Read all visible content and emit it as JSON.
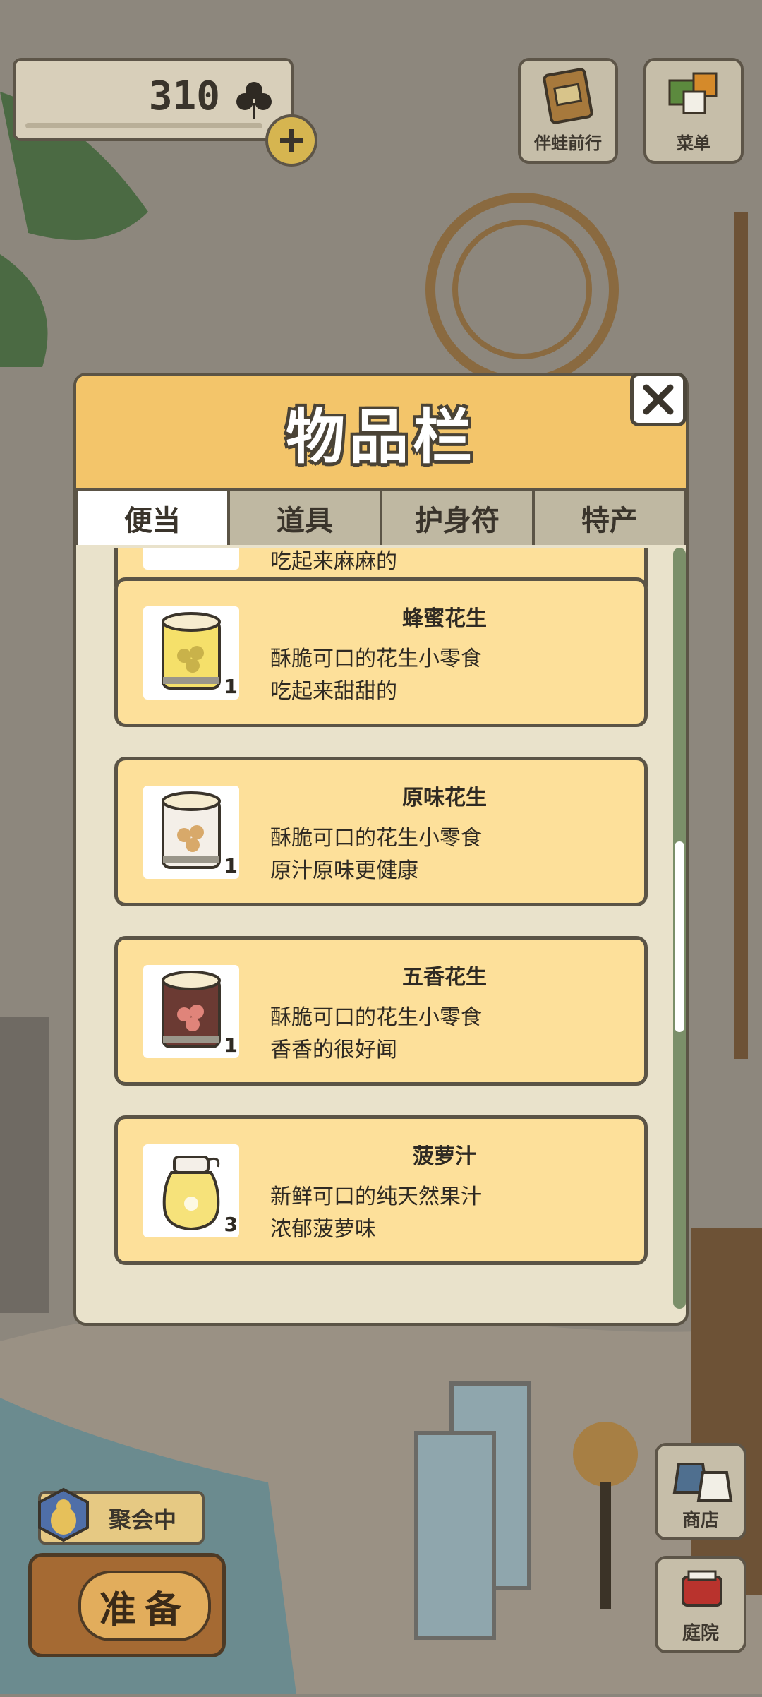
{
  "hud": {
    "clover_count": "310",
    "travel_label": "伴蛙前行",
    "menu_label": "菜单"
  },
  "inventory": {
    "title": "物品栏",
    "tabs": [
      "便当",
      "道具",
      "护身符",
      "特产"
    ],
    "active_tab": "便当",
    "partial_top_item_desc": "吃起来麻麻的",
    "items": [
      {
        "name": "蜂蜜花生",
        "desc1": "酥脆可口的花生小零食",
        "desc2": "吃起来甜甜的",
        "qty": "1",
        "icon": "honey-peanut-can"
      },
      {
        "name": "原味花生",
        "desc1": "酥脆可口的花生小零食",
        "desc2": "原汁原味更健康",
        "qty": "1",
        "icon": "plain-peanut-can"
      },
      {
        "name": "五香花生",
        "desc1": "酥脆可口的花生小零食",
        "desc2": "香香的很好闻",
        "qty": "1",
        "icon": "spiced-peanut-can"
      },
      {
        "name": "菠萝汁",
        "desc1": "新鲜可口的纯天然果汁",
        "desc2": "浓郁菠萝味",
        "qty": "3",
        "icon": "pineapple-juice-jar"
      }
    ]
  },
  "bottom": {
    "party_label": "聚会中",
    "prepare_label": "准备",
    "shop_label": "商店",
    "yard_label": "庭院"
  }
}
